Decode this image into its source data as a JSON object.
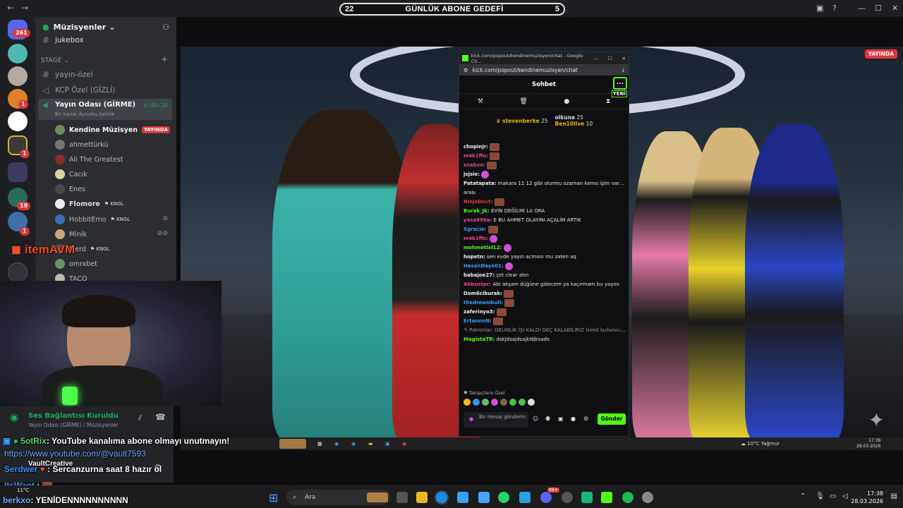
{
  "top": {
    "goal_left": "22",
    "goal_title": "GÜNLÜK ABONE GEDEFİ",
    "goal_right": "5"
  },
  "server_rail": {
    "badges": [
      "261",
      "1",
      "1",
      "19",
      "1"
    ]
  },
  "guild": {
    "name": "Müzisyenler",
    "channels_top": [
      "jukebox"
    ],
    "section": "STAGE",
    "channels": [
      "yayın-özel",
      "KCP Özel (GİZLİ)"
    ],
    "voice_channel": "Yayın Odası (GİRME)",
    "voice_status": "Bir kanal durumu belirle",
    "voice_timer": "6:08:28",
    "users": [
      {
        "name": "Kendine Müzisyen",
        "tag": "YAYINDA"
      },
      {
        "name": "ahmettürkü",
        "tag": ""
      },
      {
        "name": "Ali The Greatest",
        "tag": ""
      },
      {
        "name": "Cacık",
        "tag": ""
      },
      {
        "name": "Enes",
        "tag": ""
      },
      {
        "name": "Flomore",
        "tag": "KNGL"
      },
      {
        "name": "HobbitEmo",
        "tag": "KNGL"
      },
      {
        "name": "Minik",
        "tag": ""
      },
      {
        "name": "Merd",
        "tag": "KNGL"
      },
      {
        "name": "omrxbet",
        "tag": ""
      },
      {
        "name": "TACO",
        "tag": ""
      }
    ],
    "itemsatvm": "itemAVM"
  },
  "stream": {
    "live_badge": "YAYINDA"
  },
  "chat": {
    "title_url": "kick.com/popout/kendinemuzisyen/chat - Google Ch...",
    "url": "kick.com/popout/kendinemuzisyen/chat",
    "header": "Sohbet",
    "more": "...",
    "yeni": "YENİ",
    "leader1": "stevenberke",
    "leader1_val": "25",
    "leader2": "olkuna",
    "leader2_val": "25",
    "leader3": "Ben10live",
    "leader3_val": "10",
    "messages": [
      {
        "user": "chopinjr:",
        "color": "#f2f2f2",
        "text": "",
        "emote": "brown"
      },
      {
        "user": "m4k1ffo:",
        "color": "#e14a8b",
        "text": "",
        "emote": "brown"
      },
      {
        "user": "esabvo:",
        "color": "#e14a8b",
        "text": "",
        "emote": "brown"
      },
      {
        "user": "jsjsie:",
        "color": "#f2f2f2",
        "text": "",
        "emote": "pink"
      },
      {
        "user": "Patatapata:",
        "color": "#f2f2f2",
        "text": "makara 11 12 gibi olurmu ozaman kemo işim var 8-10",
        "emote": ""
      },
      {
        "user": "",
        "color": "#f2f2f2",
        "text": "arası",
        "emote": ""
      },
      {
        "user": "NinjaDoct:",
        "color": "#e0383c",
        "text": "",
        "emote": "brown"
      },
      {
        "user": "Burak_Jk:",
        "color": "#53fc18",
        "text": "EVİN DEĞİLMİ LA ORA",
        "emote": ""
      },
      {
        "user": "yasa999a:",
        "color": "#e14a8b",
        "text": "E BU AHMET OLAYINI AÇALİM ARTIK",
        "emote": ""
      },
      {
        "user": "Sgracie:",
        "color": "#3b9cff",
        "text": "",
        "emote": "brown"
      },
      {
        "user": "m4k1ffo:",
        "color": "#e14a8b",
        "text": "",
        "emote": "pink"
      },
      {
        "user": "mehmetixl12:",
        "color": "#53fc18",
        "text": "",
        "emote": "pink"
      },
      {
        "user": "hopetn:",
        "color": "#f2f2f2",
        "text": "sen evde yayın acmıon mu zaten aq",
        "emote": ""
      },
      {
        "user": "HasanDaye01:",
        "color": "#3b9cff",
        "text": "",
        "emote": "pink"
      },
      {
        "user": "babajoe27:",
        "color": "#f2f2f2",
        "text": "çet clear atın",
        "emote": ""
      },
      {
        "user": "Abbustpr:",
        "color": "#e14a8b",
        "text": "Abi akşam düğüne gidecem ya kaçırmam bu yayını",
        "emote": ""
      },
      {
        "user": "Dom6ciburak:",
        "color": "#f2f2f2",
        "text": "",
        "emote": "brown"
      },
      {
        "user": "thedreambull:",
        "color": "#3b9cff",
        "text": "",
        "emote": "brown"
      },
      {
        "user": "zaferinyo3:",
        "color": "#f2f2f2",
        "text": "",
        "emote": "brown"
      },
      {
        "user": "ErtannnN:",
        "color": "#3b9cff",
        "text": "",
        "emote": "brown"
      },
      {
        "user": "",
        "color": "#9a9a9a",
        "text": "↰ Patronlar: GELİNLİK İŞİ KALDI GEÇ KALABİLİRİZ İsimli kullanıcıya ya...",
        "emote": ""
      },
      {
        "user": "MagistaTR:",
        "color": "#53fc18",
        "text": "dskjdsajdsajkldjksads",
        "emote": ""
      }
    ],
    "followers_only": "Takipçilere Özel",
    "input_placeholder": "Bir mesaj gönderin",
    "send": "Gönder"
  },
  "inner_taskbar": {
    "weather": "10°C  Yağmur",
    "time": "17:38",
    "date": "28.03.2026"
  },
  "voice": {
    "status": "Ses Bağlantısı Kuruldu",
    "channel": "Yayın Odası (GİRME) / Müzisyenler"
  },
  "overlay_chat": {
    "line1_user": "5otRix",
    "line1_text": ": YouTube kanalıma abone olmayı unutmayın!",
    "line2_link": "https://www.youtube.com/@vault7593",
    "vault": "VaultCreative",
    "line3_user": "Serdwer",
    "line3_text": ": Sercanzurna saat 8 hazır ol",
    "line4_user": "ItsWant",
    "line4_text": ":",
    "line5_user": "berkxo",
    "line5_text": ": YENİDENNNNNNNNNN",
    "weather_small": "11°C"
  },
  "taskbar": {
    "search": "Ara",
    "time": "17:38",
    "date": "28.03.2026",
    "notif": "99+"
  }
}
